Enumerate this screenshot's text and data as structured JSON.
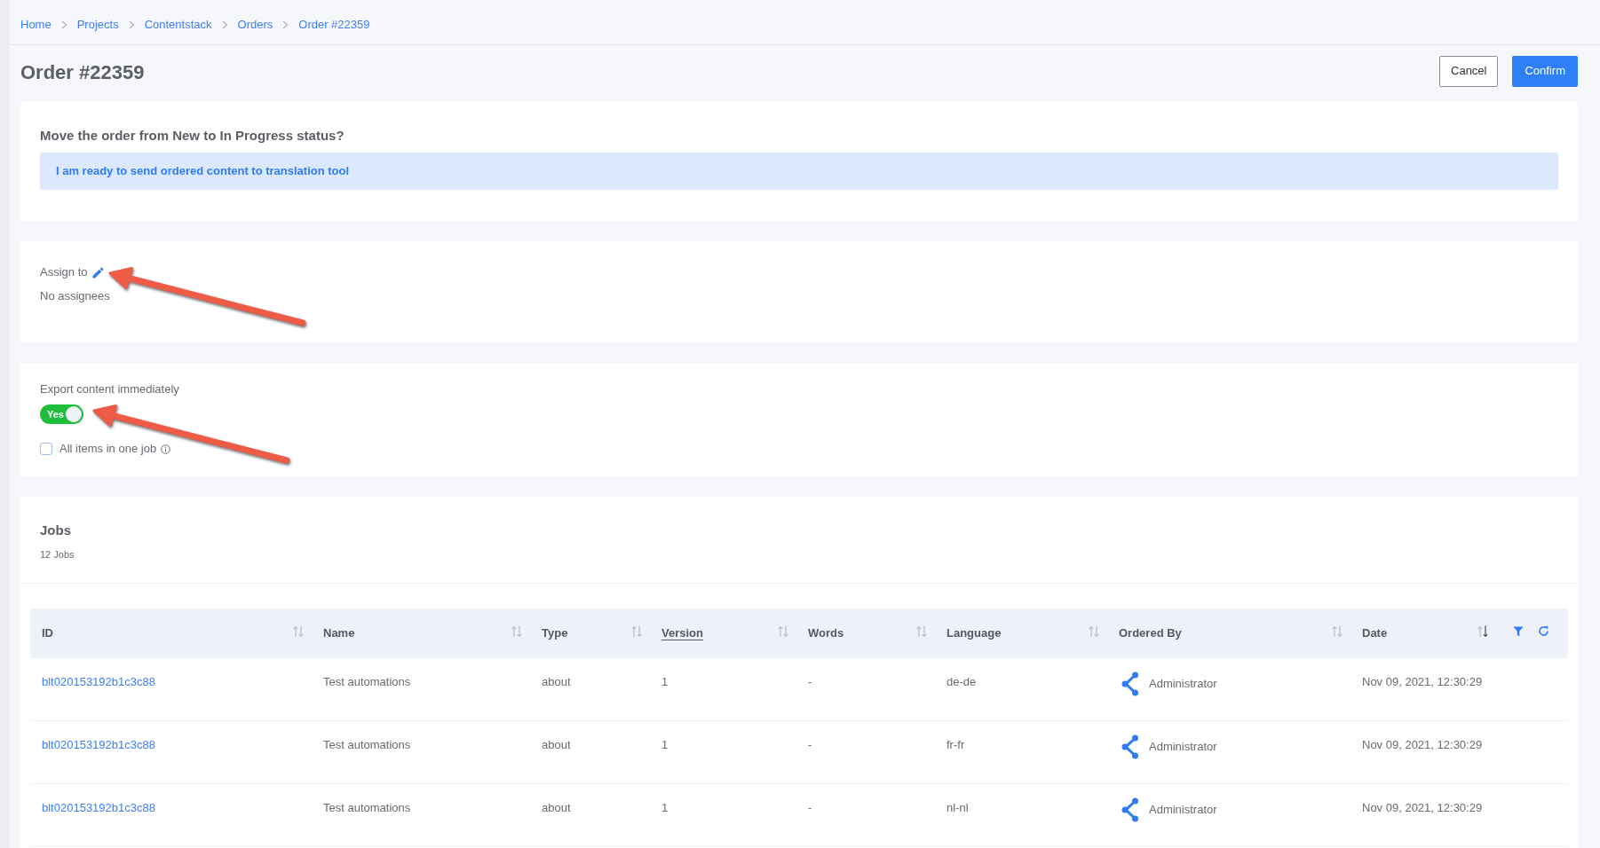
{
  "breadcrumb": [
    "Home",
    "Projects",
    "Contentstack",
    "Orders",
    "Order #22359"
  ],
  "page_title": "Order #22359",
  "actions": [
    {
      "label": "Cancel",
      "kind": "cancel"
    },
    {
      "label": "Confirm",
      "kind": "confirm"
    }
  ],
  "status_change": {
    "question": "Move the order from New to In Progress status?",
    "message": "I am ready to send ordered content to translation tool"
  },
  "assign": {
    "label": "Assign to",
    "value": "No assignees",
    "annotation_arrow": true
  },
  "export": {
    "label": "Export content immediately",
    "annotation_arrow": true,
    "toggle": {
      "label": "Yes",
      "on": true
    },
    "all_items_in_one_job": {
      "label": "All items in one job",
      "checked": false
    }
  },
  "jobs": {
    "title": "Jobs",
    "count": "12 Jobs",
    "table": {
      "columns": [
        {
          "label": "ID",
          "kind": "link",
          "sorted_descending": false,
          "underlined": false
        },
        {
          "label": "Name",
          "kind": "text",
          "sorted_descending": false,
          "underlined": false
        },
        {
          "label": "Type",
          "kind": "text",
          "sorted_descending": false,
          "underlined": false
        },
        {
          "label": "Version",
          "kind": "text",
          "sorted_descending": false,
          "underlined": true
        },
        {
          "label": "Words",
          "kind": "text",
          "sorted_descending": false,
          "underlined": false
        },
        {
          "label": "Language",
          "kind": "text",
          "sorted_descending": false,
          "underlined": false
        },
        {
          "label": "Ordered By",
          "kind": "user",
          "sorted_descending": false,
          "underlined": false
        },
        {
          "label": "Date",
          "kind": "text",
          "sorted_descending": true,
          "underlined": false
        }
      ],
      "rows": [
        {
          "cells": [
            "blt020153192b1c3c88",
            "Test automations",
            "about",
            "1",
            "-",
            "de-de",
            "Administrator",
            "Nov 09, 2021, 12:30:29"
          ]
        },
        {
          "cells": [
            "blt020153192b1c3c88",
            "Test automations",
            "about",
            "1",
            "-",
            "fr-fr",
            "Administrator",
            "Nov 09, 2021, 12:30:29"
          ]
        },
        {
          "cells": [
            "blt020153192b1c3c88",
            "Test automations",
            "about",
            "1",
            "-",
            "nl-nl",
            "Administrator",
            "Nov 09, 2021, 12:30:29"
          ]
        }
      ]
    }
  }
}
